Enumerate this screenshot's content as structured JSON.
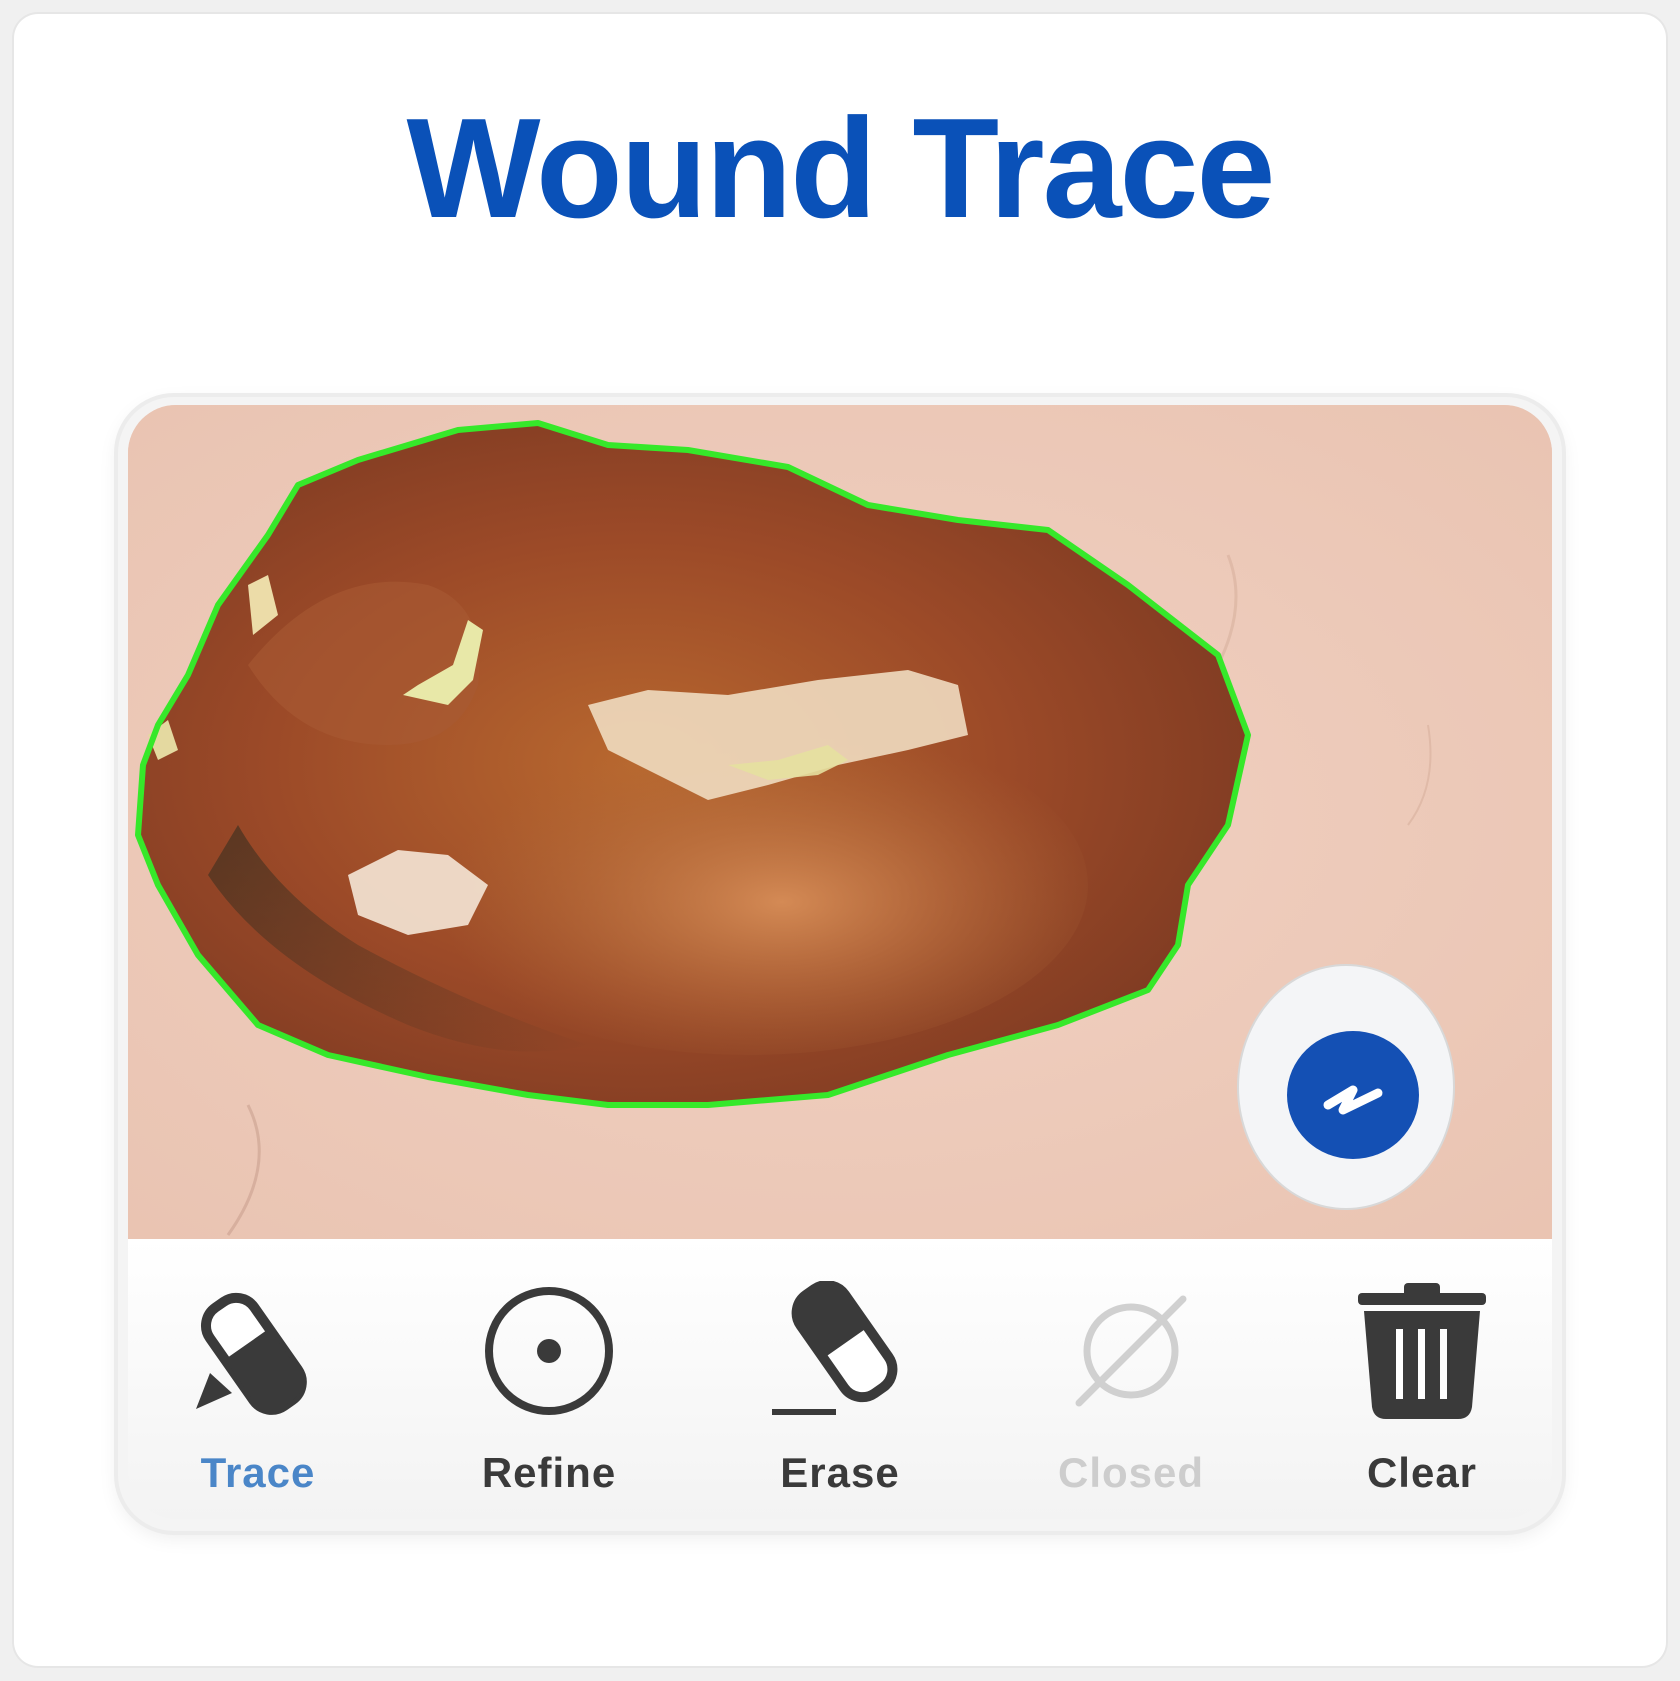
{
  "page": {
    "title": "Wound Trace"
  },
  "toolbar": {
    "items": [
      {
        "label": "Trace",
        "icon": "pencil-eraser-icon",
        "state": "active"
      },
      {
        "label": "Refine",
        "icon": "target-circle-icon",
        "state": "normal"
      },
      {
        "label": "Erase",
        "icon": "eraser-icon",
        "state": "normal"
      },
      {
        "label": "Closed",
        "icon": "empty-set-icon",
        "state": "disabled"
      },
      {
        "label": "Clear",
        "icon": "trash-icon",
        "state": "normal"
      }
    ]
  },
  "colors": {
    "title": "#0a51b8",
    "trace_outline": "#36e82a",
    "active_label": "#4a86c8",
    "disabled_label": "#cdcdcd",
    "icon": "#3a3a3a",
    "badge": "#1450b4"
  }
}
